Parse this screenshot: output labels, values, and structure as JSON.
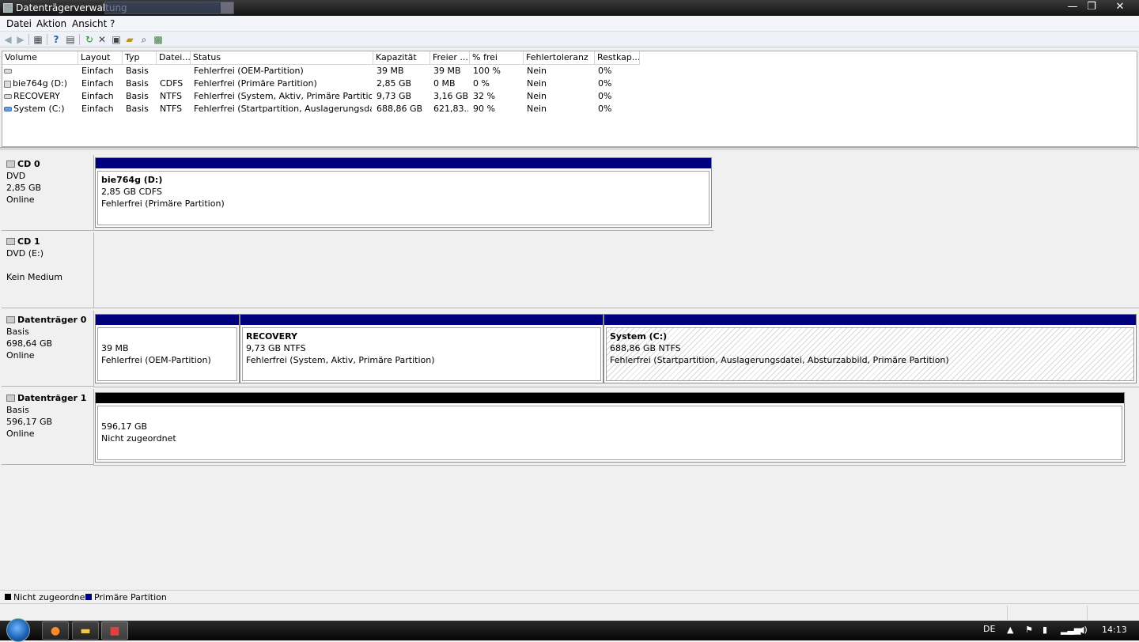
{
  "window": {
    "title": "Datenträgerverwaltung",
    "controls": {
      "minimize": "—",
      "maximize": "❐",
      "close": "✕"
    }
  },
  "menu": [
    "Datei",
    "Aktion",
    "Ansicht",
    "?"
  ],
  "toolbar": {
    "icons": [
      "back-icon",
      "forward-icon",
      "console-tree-icon",
      "help-icon",
      "properties-icon",
      "refresh-icon",
      "delete-icon",
      "properties-sheet-icon",
      "open-icon",
      "search-icon",
      "disk-icon"
    ]
  },
  "volumes": {
    "columns": [
      "Volume",
      "Layout",
      "Typ",
      "Datei...",
      "Status",
      "Kapazität",
      "Freier ...",
      "% frei",
      "Fehlertoleranz",
      "Restkap..."
    ],
    "rows": [
      {
        "icon": "drive-icon",
        "volume": "",
        "layout": "Einfach",
        "type": "Basis",
        "fs": "",
        "status": "Fehlerfrei (OEM-Partition)",
        "capacity": "39 MB",
        "free": "39 MB",
        "pct": "100 %",
        "fault": "Nein",
        "overhead": "0%"
      },
      {
        "icon": "cd-drive-icon",
        "volume": "bie764g (D:)",
        "layout": "Einfach",
        "type": "Basis",
        "fs": "CDFS",
        "status": "Fehlerfrei (Primäre Partition)",
        "capacity": "2,85 GB",
        "free": "0 MB",
        "pct": "0 %",
        "fault": "Nein",
        "overhead": "0%"
      },
      {
        "icon": "drive-icon",
        "volume": "RECOVERY",
        "layout": "Einfach",
        "type": "Basis",
        "fs": "NTFS",
        "status": "Fehlerfrei (System, Aktiv, Primäre Partition)",
        "capacity": "9,73 GB",
        "free": "3,16 GB",
        "pct": "32 %",
        "fault": "Nein",
        "overhead": "0%"
      },
      {
        "icon": "system-drive-icon",
        "volume": "System (C:)",
        "layout": "Einfach",
        "type": "Basis",
        "fs": "NTFS",
        "status": "Fehlerfrei (Startpartition, Auslagerungsdate...",
        "capacity": "688,86 GB",
        "free": "621,83...",
        "pct": "90 %",
        "fault": "Nein",
        "overhead": "0%"
      }
    ]
  },
  "disks": [
    {
      "name": "CD 0",
      "line1": "DVD",
      "line2": "2,85 GB",
      "line3": "Online",
      "partitions": [
        {
          "name": "bie764g  (D:)",
          "size": "2,85 GB CDFS",
          "status": "Fehlerfrei (Primäre Partition)"
        }
      ]
    },
    {
      "name": "CD 1",
      "line1": "DVD (E:)",
      "line2": "",
      "line3": "Kein Medium",
      "partitions": []
    },
    {
      "name": "Datenträger 0",
      "line1": "Basis",
      "line2": "698,64 GB",
      "line3": "Online",
      "partitions": [
        {
          "name": "",
          "size": "39 MB",
          "status": "Fehlerfrei (OEM-Partition)"
        },
        {
          "name": "RECOVERY",
          "size": "9,73 GB NTFS",
          "status": "Fehlerfrei (System, Aktiv, Primäre Partition)"
        },
        {
          "name": "System  (C:)",
          "size": "688,86 GB NTFS",
          "status": "Fehlerfrei (Startpartition, Auslagerungsdatei, Absturzabbild, Primäre Partition)"
        }
      ]
    },
    {
      "name": "Datenträger 1",
      "line1": "Basis",
      "line2": "596,17 GB",
      "line3": "Online",
      "partitions": [
        {
          "name": "",
          "size": "596,17 GB",
          "status": "Nicht zugeordnet"
        }
      ]
    }
  ],
  "legend": [
    {
      "label": "Nicht zugeordnet",
      "color": "#000000"
    },
    {
      "label": "Primäre Partition",
      "color": "#00007f"
    }
  ],
  "taskbar": {
    "apps": [
      "firefox-icon",
      "explorer-icon",
      "disk-management-icon"
    ],
    "language": "DE",
    "time": "14:13"
  },
  "colors": {
    "primary_partition": "#00007f",
    "unallocated": "#000000"
  }
}
